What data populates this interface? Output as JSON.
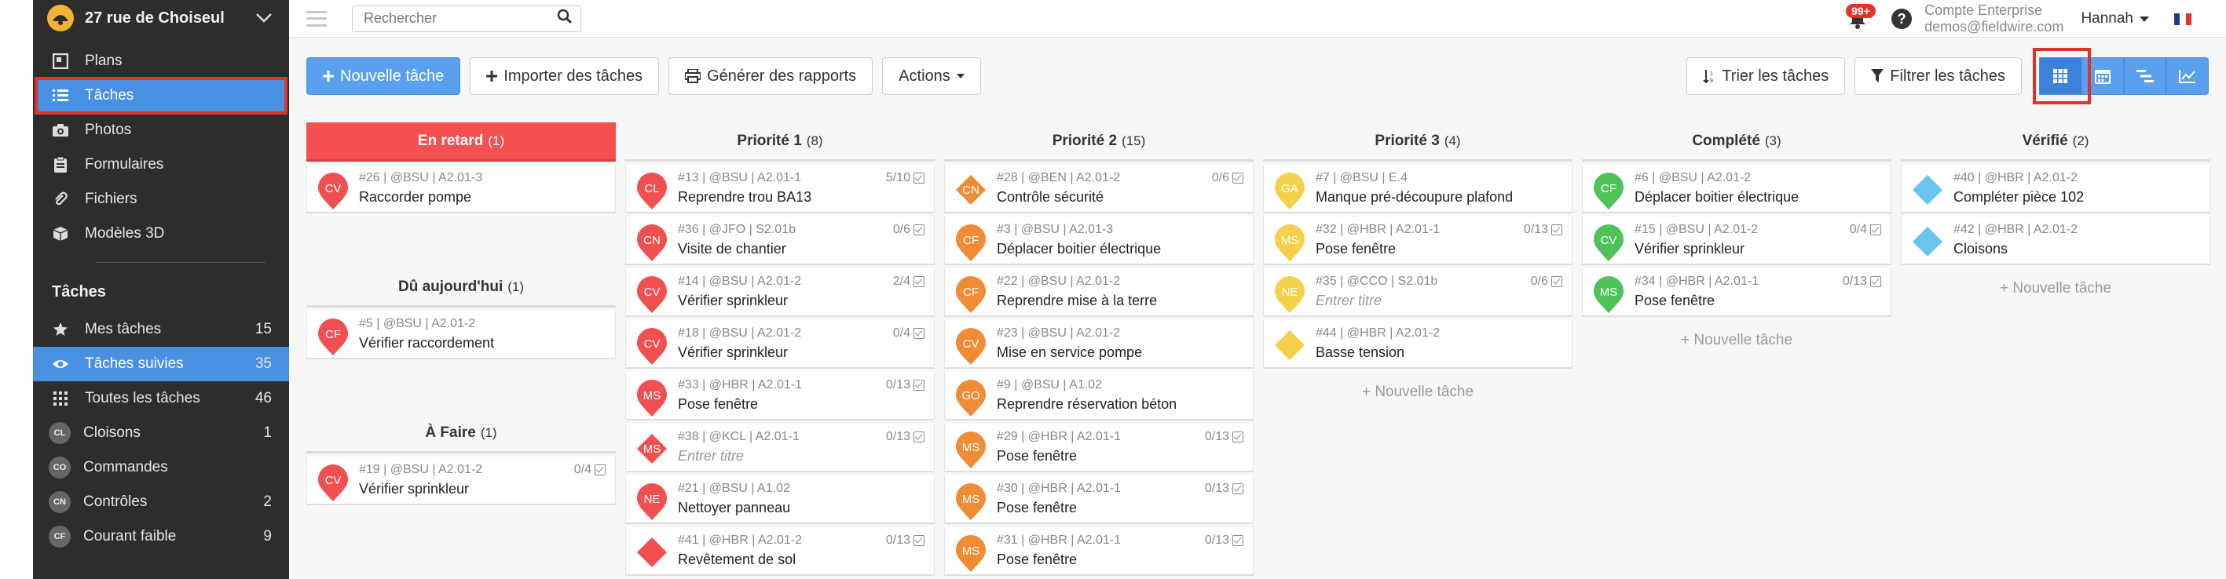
{
  "sidebar": {
    "project_name": "27 rue de Choiseul",
    "nav": [
      {
        "label": "Plans",
        "icon": "plan-icon"
      },
      {
        "label": "Tâches",
        "icon": "list-icon"
      },
      {
        "label": "Photos",
        "icon": "camera-icon"
      },
      {
        "label": "Formulaires",
        "icon": "clipboard-icon"
      },
      {
        "label": "Fichiers",
        "icon": "paperclip-icon"
      },
      {
        "label": "Modèles 3D",
        "icon": "cube-icon"
      }
    ],
    "section_title": "Tâches",
    "task_filters": [
      {
        "label": "Mes tâches",
        "count": "15",
        "icon": "star-icon"
      },
      {
        "label": "Tâches suivies",
        "count": "35",
        "icon": "eye-icon"
      },
      {
        "label": "Toutes les tâches",
        "count": "46",
        "icon": "grid-icon"
      },
      {
        "label": "Cloisons",
        "count": "1",
        "badge": "CL"
      },
      {
        "label": "Commandes",
        "count": "",
        "badge": "CO"
      },
      {
        "label": "Contrôles",
        "count": "2",
        "badge": "CN"
      },
      {
        "label": "Courant faible",
        "count": "9",
        "badge": "CF"
      }
    ]
  },
  "topbar": {
    "search_placeholder": "Rechercher",
    "notifications": "99+",
    "help": "?",
    "account_name": "Compte Enterprise",
    "account_email": "demos@fieldwire.com",
    "user": "Hannah"
  },
  "toolbar": {
    "new_task": "Nouvelle tâche",
    "import": "Importer des tâches",
    "reports": "Générer des rapports",
    "actions": "Actions",
    "sort": "Trier les tâches",
    "filter": "Filtrer les tâches"
  },
  "colors": {
    "red": "#f05050",
    "orange": "#f08c35",
    "yellow": "#f5d04a",
    "green": "#4fc35a",
    "blue": "#6cc4ee",
    "accent": "#4a90e2"
  },
  "board": {
    "new_task_label": "+ Nouvelle tâche",
    "col1": {
      "late": {
        "title": "En retard",
        "count": "(1)",
        "cards": [
          {
            "initials": "CV",
            "shape": "pin",
            "color": "red",
            "meta": "#26 | @BSU | A2.01-3",
            "title": "Raccorder pompe",
            "checks": ""
          }
        ]
      },
      "today": {
        "title": "Dû aujourd'hui",
        "count": "(1)",
        "cards": [
          {
            "initials": "CF",
            "shape": "pin",
            "color": "red",
            "meta": "#5 | @BSU | A2.01-2",
            "title": "Vérifier raccordement",
            "checks": ""
          }
        ]
      },
      "todo": {
        "title": "À Faire",
        "count": "(1)",
        "cards": [
          {
            "initials": "CV",
            "shape": "pin",
            "color": "red",
            "meta": "#19 | @BSU | A2.01-2",
            "title": "Vérifier sprinkleur",
            "checks": "0/4"
          }
        ]
      }
    },
    "columns": [
      {
        "title": "Priorité 1",
        "count": "(8)",
        "new": false,
        "cards": [
          {
            "initials": "CL",
            "shape": "pin",
            "color": "red",
            "meta": "#13 | @BSU | A2.01-1",
            "title": "Reprendre trou BA13",
            "checks": "5/10"
          },
          {
            "initials": "CN",
            "shape": "pin",
            "color": "red",
            "meta": "#36 | @JFO | S2.01b",
            "title": "Visite de chantier",
            "checks": "0/6"
          },
          {
            "initials": "CV",
            "shape": "pin",
            "color": "red",
            "meta": "#14 | @BSU | A2.01-2",
            "title": "Vérifier sprinkleur",
            "checks": "2/4"
          },
          {
            "initials": "CV",
            "shape": "pin",
            "color": "red",
            "meta": "#18 | @BSU | A2.01-2",
            "title": "Vérifier sprinkleur",
            "checks": "0/4"
          },
          {
            "initials": "MS",
            "shape": "pin",
            "color": "red",
            "meta": "#33 | @HBR | A2.01-1",
            "title": "Pose fenêtre",
            "checks": "0/13"
          },
          {
            "initials": "MS",
            "shape": "diamond",
            "color": "red",
            "meta": "#38 | @KCL | A2.01-1",
            "title": "Entrer titre",
            "placeholder": true,
            "checks": "0/13"
          },
          {
            "initials": "NE",
            "shape": "pin",
            "color": "red",
            "meta": "#21 | @BSU | A1.02",
            "title": "Nettoyer panneau",
            "checks": ""
          },
          {
            "initials": "",
            "shape": "diamond",
            "color": "red",
            "meta": "#41 | @HBR | A2.01-2",
            "title": "Revêtement de sol",
            "checks": "0/13"
          }
        ]
      },
      {
        "title": "Priorité 2",
        "count": "(15)",
        "new": false,
        "cards": [
          {
            "initials": "CN",
            "shape": "diamond",
            "color": "orange",
            "meta": "#28 | @BEN | A2.01-2",
            "title": "Contrôle sécurité",
            "checks": "0/6"
          },
          {
            "initials": "CF",
            "shape": "pin",
            "color": "orange",
            "meta": "#3 | @BSU | A2.01-3",
            "title": "Déplacer boitier électrique",
            "checks": ""
          },
          {
            "initials": "CF",
            "shape": "pin",
            "color": "orange",
            "meta": "#22 | @BSU | A2.01-2",
            "title": "Reprendre mise à la terre",
            "checks": ""
          },
          {
            "initials": "CV",
            "shape": "pin",
            "color": "orange",
            "meta": "#23 | @BSU | A2.01-2",
            "title": "Mise en service pompe",
            "checks": ""
          },
          {
            "initials": "GO",
            "shape": "pin",
            "color": "orange",
            "meta": "#9 | @BSU | A1.02",
            "title": "Reprendre réservation béton",
            "checks": ""
          },
          {
            "initials": "MS",
            "shape": "pin",
            "color": "orange",
            "meta": "#29 | @HBR | A2.01-1",
            "title": "Pose fenêtre",
            "checks": "0/13"
          },
          {
            "initials": "MS",
            "shape": "pin",
            "color": "orange",
            "meta": "#30 | @HBR | A2.01-1",
            "title": "Pose fenêtre",
            "checks": "0/13"
          },
          {
            "initials": "MS",
            "shape": "pin",
            "color": "orange",
            "meta": "#31 | @HBR | A2.01-1",
            "title": "Pose fenêtre",
            "checks": "0/13"
          }
        ]
      },
      {
        "title": "Priorité 3",
        "count": "(4)",
        "new": true,
        "cards": [
          {
            "initials": "GA",
            "shape": "pin",
            "color": "yellow",
            "meta": "#7 | @BSU | E.4",
            "title": "Manque pré-découpure plafond",
            "checks": ""
          },
          {
            "initials": "MS",
            "shape": "pin",
            "color": "yellow",
            "meta": "#32 | @HBR | A2.01-1",
            "title": "Pose fenêtre",
            "checks": "0/13"
          },
          {
            "initials": "NE",
            "shape": "pin",
            "color": "yellow",
            "meta": "#35 | @CCO | S2.01b",
            "title": "Entrer titre",
            "placeholder": true,
            "checks": "0/6"
          },
          {
            "initials": "",
            "shape": "diamond",
            "color": "yellow",
            "meta": "#44 | @HBR | A2.01-2",
            "title": "Basse tension",
            "checks": ""
          }
        ]
      },
      {
        "title": "Complété",
        "count": "(3)",
        "new": true,
        "cards": [
          {
            "initials": "CF",
            "shape": "pin",
            "color": "green",
            "meta": "#6 | @BSU | A2.01-2",
            "title": "Déplacer boitier électrique",
            "checks": ""
          },
          {
            "initials": "CV",
            "shape": "pin",
            "color": "green",
            "meta": "#15 | @BSU | A2.01-2",
            "title": "Vérifier sprinkleur",
            "checks": "0/4"
          },
          {
            "initials": "MS",
            "shape": "pin",
            "color": "green",
            "meta": "#34 | @HBR | A2.01-1",
            "title": "Pose fenêtre",
            "checks": "0/13"
          }
        ]
      },
      {
        "title": "Vérifié",
        "count": "(2)",
        "new": true,
        "cards": [
          {
            "initials": "",
            "shape": "diamond",
            "color": "blue",
            "meta": "#40 | @HBR | A2.01-2",
            "title": "Compléter pièce 102",
            "checks": ""
          },
          {
            "initials": "",
            "shape": "diamond",
            "color": "blue",
            "meta": "#42 | @HBR | A2.01-2",
            "title": "Cloisons",
            "checks": ""
          }
        ]
      }
    ]
  }
}
